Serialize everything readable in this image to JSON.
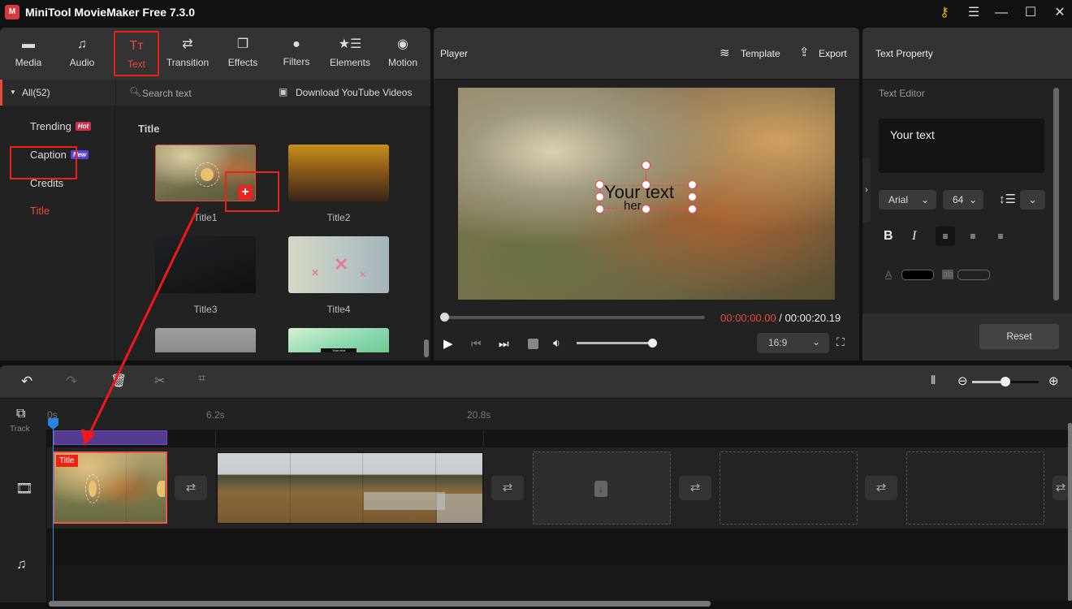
{
  "app": {
    "title": "MiniTool MovieMaker Free 7.3.0",
    "logo_glyph": "M",
    "window_buttons": [
      {
        "name": "key-icon",
        "glyph": "⚷"
      },
      {
        "name": "menu-icon",
        "glyph": "☰"
      },
      {
        "name": "minimize-icon",
        "glyph": "—"
      },
      {
        "name": "maximize-icon",
        "glyph": "☐"
      },
      {
        "name": "close-icon",
        "glyph": "✕"
      }
    ]
  },
  "toolbar": {
    "tabs": [
      {
        "label": "Media",
        "icon": "folder-icon",
        "glyph": "▬",
        "active": false
      },
      {
        "label": "Audio",
        "icon": "music-icon",
        "glyph": "♫",
        "active": false
      },
      {
        "label": "Text",
        "icon": "text-icon",
        "glyph": "Tт",
        "active": true
      },
      {
        "label": "Transition",
        "icon": "transition-icon",
        "glyph": "⇄",
        "active": false
      },
      {
        "label": "Effects",
        "icon": "effects-icon",
        "glyph": "❐",
        "active": false
      },
      {
        "label": "Filters",
        "icon": "filters-icon",
        "glyph": "●",
        "active": false
      },
      {
        "label": "Elements",
        "icon": "elements-icon",
        "glyph": "★☰",
        "active": false
      },
      {
        "label": "Motion",
        "icon": "motion-icon",
        "glyph": "◉",
        "active": false
      }
    ]
  },
  "sidebar": {
    "all_label": "All(52)",
    "caret": "▼",
    "items": [
      {
        "label": "Trending",
        "badge": "Hot",
        "badge_color": "#d0304a"
      },
      {
        "label": "Caption",
        "badge": "New",
        "badge_color": "#5a3ee0"
      },
      {
        "label": "Credits",
        "badge": null
      },
      {
        "label": "Title",
        "badge": null,
        "active": true
      }
    ]
  },
  "content": {
    "search_placeholder": "Search text",
    "download_label": "Download YouTube Videos",
    "section_title": "Title",
    "add_glyph": "+",
    "thumbnails": [
      {
        "label": "Title1"
      },
      {
        "label": "Title2"
      },
      {
        "label": "Title3"
      },
      {
        "label": "Title4"
      },
      {
        "label": ""
      },
      {
        "label": ""
      }
    ],
    "thumb5_text": "Your text"
  },
  "player": {
    "title": "Player",
    "template_label": "Template",
    "export_label": "Export",
    "overlay_text": "Your text",
    "overlay_subtext": "her",
    "current_time": "00:00:00.00",
    "separator": " / ",
    "total_time": "00:00:20.19",
    "progress": 0,
    "volume": 1.0,
    "aspect_ratio": "16:9",
    "accent_color": "#e84b3c"
  },
  "text_property": {
    "title": "Text Property",
    "editor_label": "Text Editor",
    "text_value": "Your text",
    "font": "Arial",
    "font_size": "64",
    "format_buttons": [
      "B",
      "I"
    ],
    "align_selected": "left",
    "text_color": "#000000",
    "bg_color": "",
    "text_color_glyph": "A",
    "bg_color_glyph": "ab",
    "reset_label": "Reset"
  },
  "timeline": {
    "ruler_labels": [
      "0s",
      "6.2s",
      "20.8s"
    ],
    "zoom_level": 0.5,
    "track_partial_label": "Track",
    "title_clip_tag": "Title",
    "transition_glyph": "⇄"
  }
}
